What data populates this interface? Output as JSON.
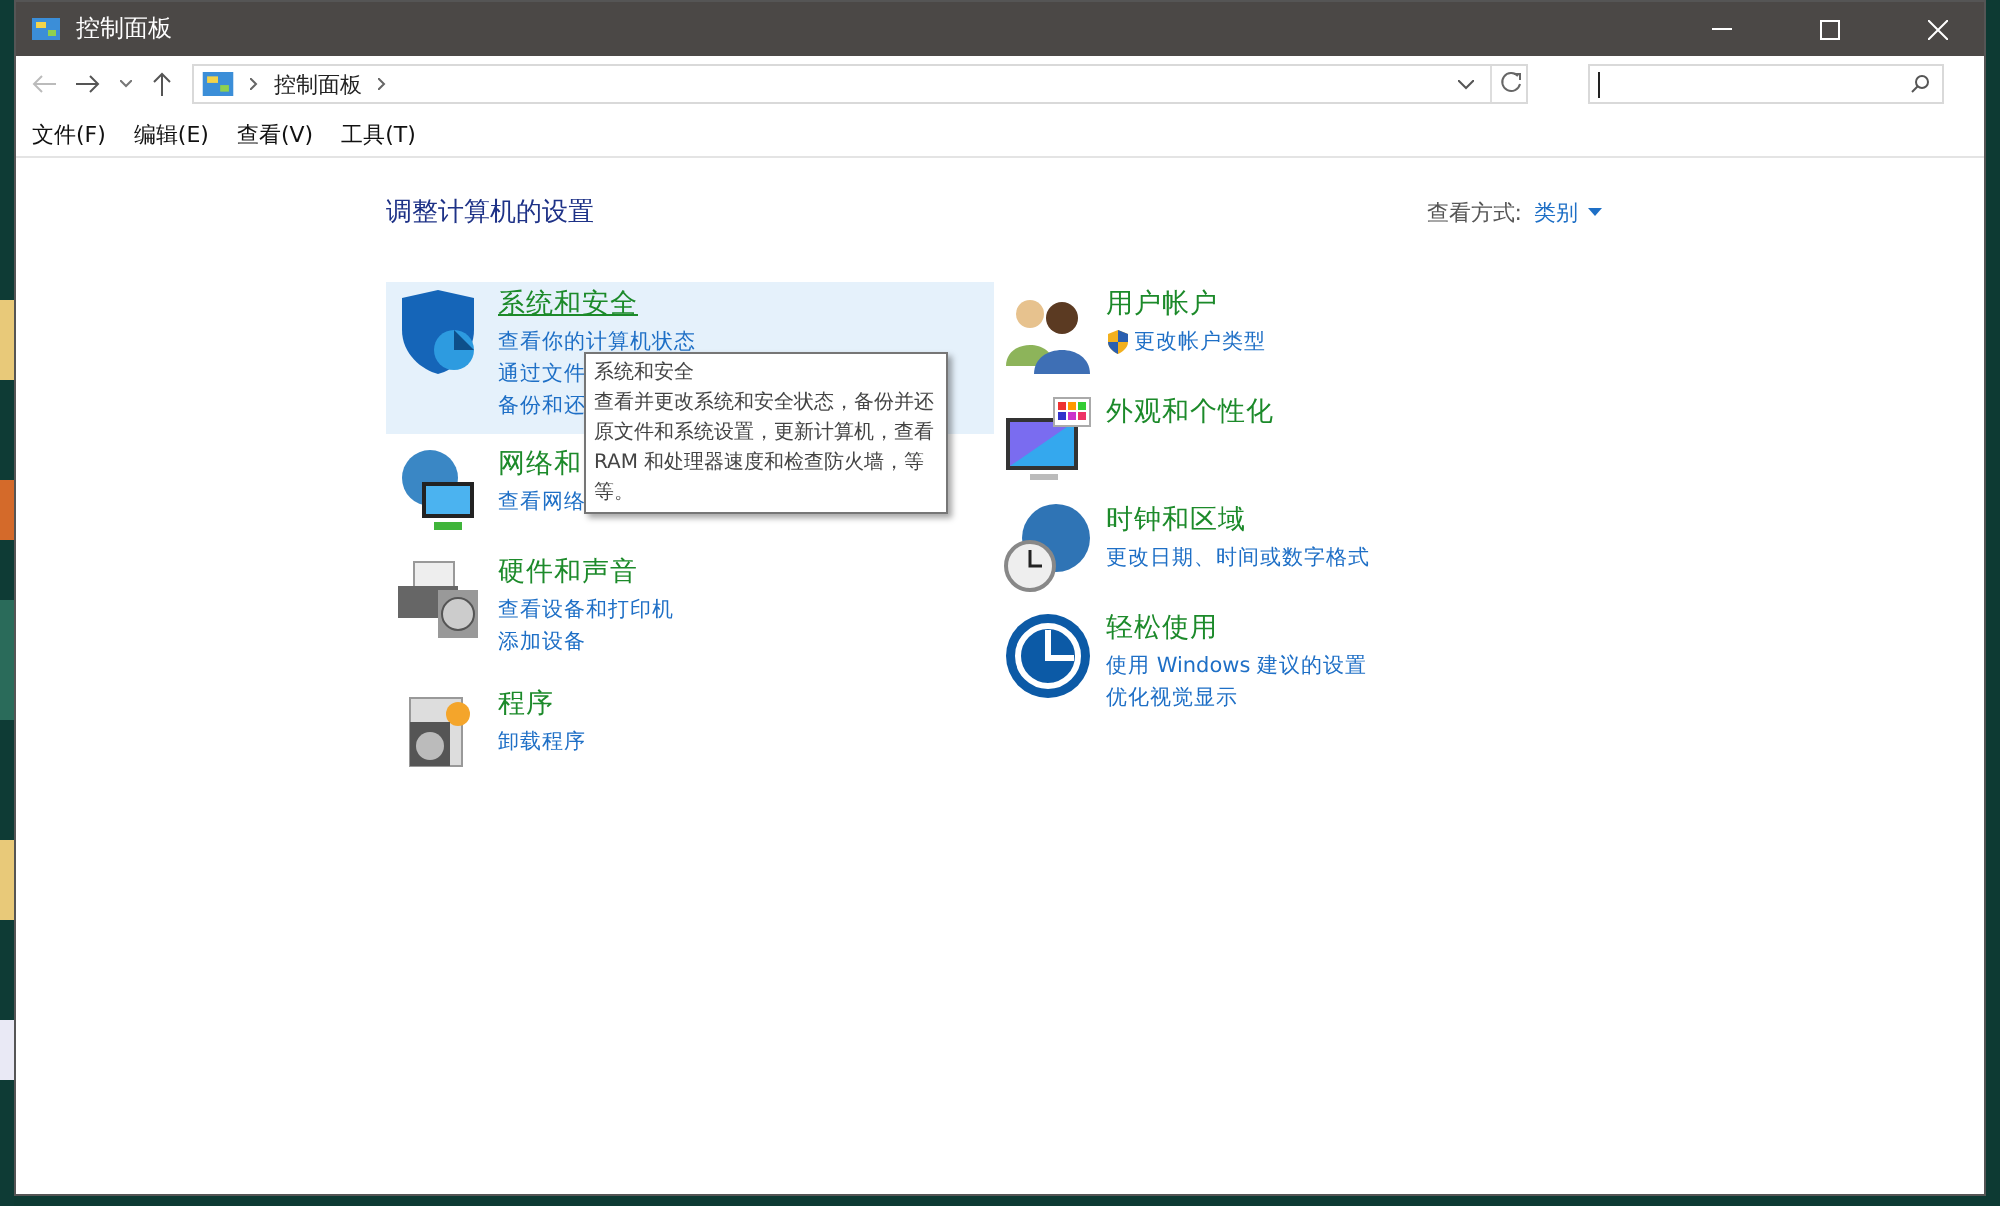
{
  "window": {
    "title": "控制面板"
  },
  "address_bar": {
    "path": [
      "控制面板"
    ]
  },
  "menu": [
    "文件(F)",
    "编辑(E)",
    "查看(V)",
    "工具(T)"
  ],
  "heading": "调整计算机的设置",
  "view_by": {
    "label": "查看方式:",
    "value": "类别"
  },
  "columns": [
    [
      {
        "kind": "shield",
        "title": "系统和安全",
        "hovered": true,
        "links": [
          "查看你的计算机状态",
          "通过文件",
          "备份和还"
        ]
      },
      {
        "kind": "network",
        "title": "网络和",
        "hovered": false,
        "links": [
          "查看网络"
        ]
      },
      {
        "kind": "printer",
        "title": "硬件和声音",
        "hovered": false,
        "links": [
          "查看设备和打印机",
          "添加设备"
        ]
      },
      {
        "kind": "programs",
        "title": "程序",
        "hovered": false,
        "links": [
          "卸载程序"
        ]
      }
    ],
    [
      {
        "kind": "users",
        "title": "用户帐户",
        "hovered": false,
        "links": [
          "更改帐户类型"
        ],
        "link_shield": true
      },
      {
        "kind": "monitor",
        "title": "外观和个性化",
        "hovered": false
      },
      {
        "kind": "clock",
        "title": "时钟和区域",
        "hovered": false,
        "links": [
          "更改日期、时间或数字格式"
        ]
      },
      {
        "kind": "ease",
        "title": "轻松使用",
        "hovered": false,
        "links": [
          "使用 Windows 建议的设置",
          "优化视觉显示"
        ]
      }
    ]
  ],
  "tooltip": {
    "title": "系统和安全",
    "text": "查看并更改系统和安全状态，备份并还原文件和系统设置，更新计算机，查看 RAM 和处理器速度和检查防火墙，等等。"
  }
}
